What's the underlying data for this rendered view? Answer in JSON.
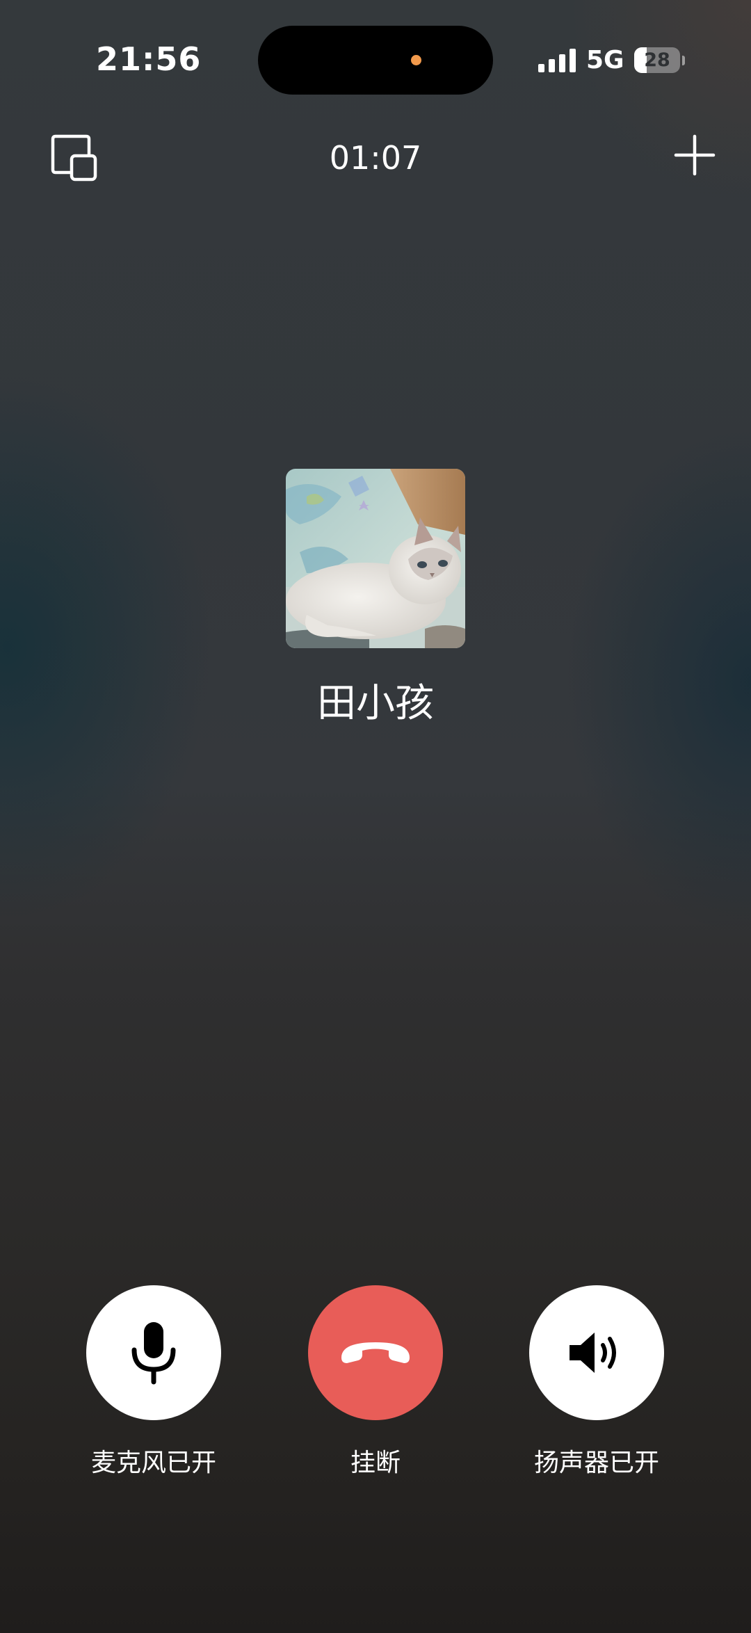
{
  "status_bar": {
    "time": "21:56",
    "network": "5G",
    "battery": "28",
    "battery_level": 0.28,
    "privacy_indicator_color": "#f29a4c"
  },
  "call": {
    "duration": "01:07",
    "caller_name": "田小孩",
    "minimize_icon": "minimize-window-icon",
    "add_icon": "plus-icon"
  },
  "controls": {
    "mic_label": "麦克风已开",
    "hangup_label": "挂断",
    "speaker_label": "扬声器已开",
    "hangup_color": "#e85d58"
  }
}
